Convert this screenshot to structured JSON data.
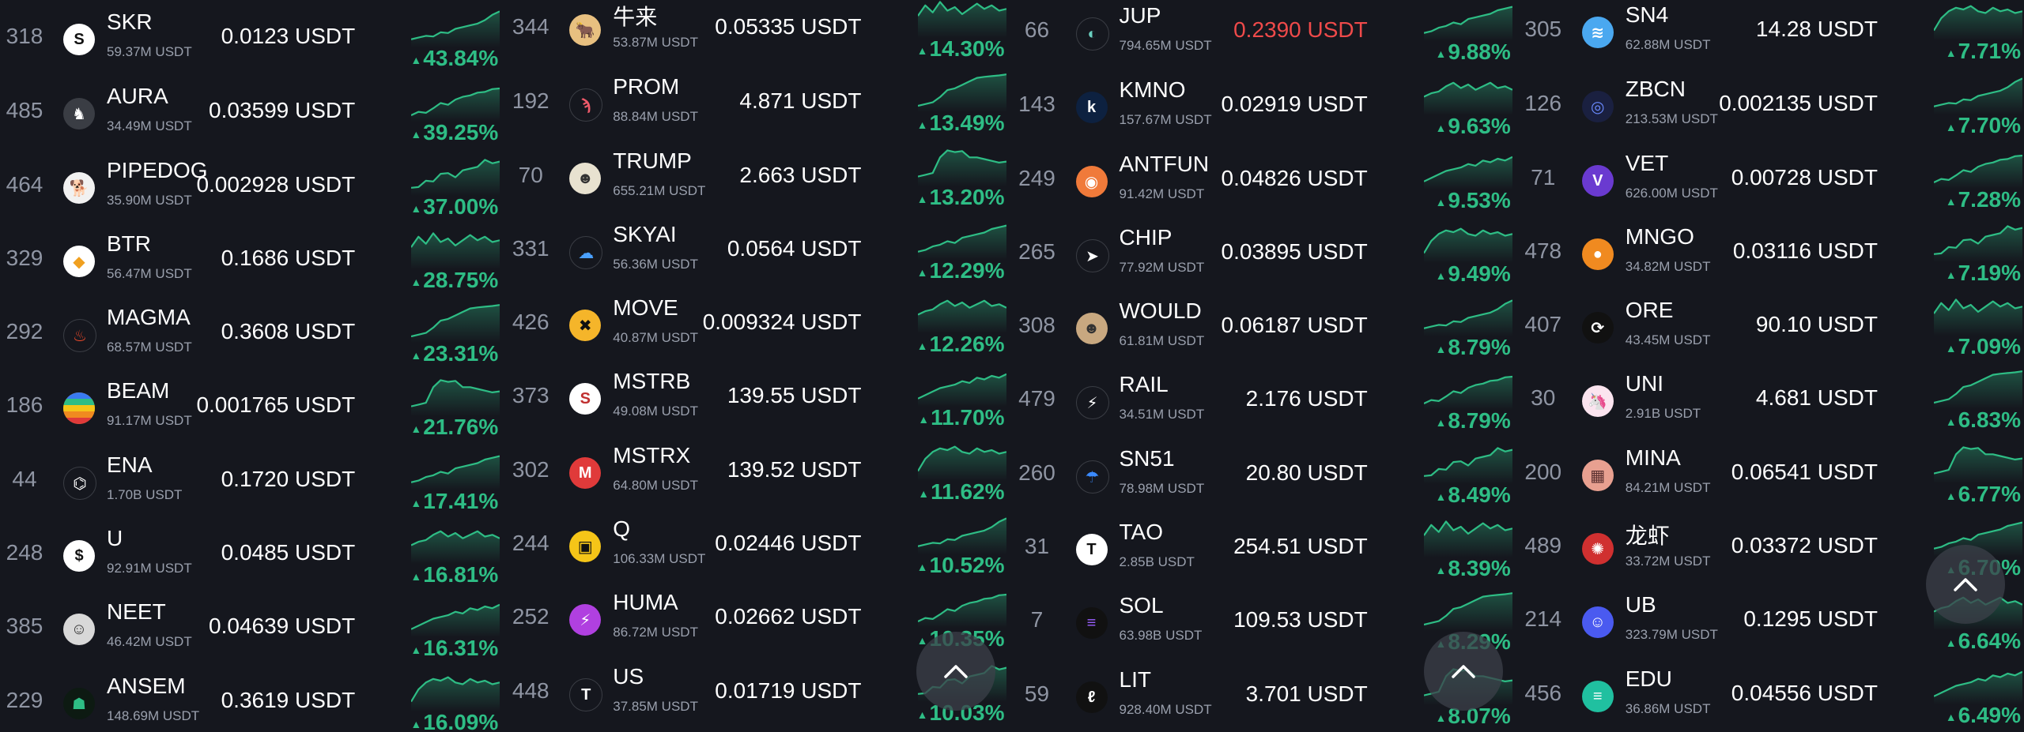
{
  "accent_up": "#2ebd85",
  "accent_down": "#ef4a4a",
  "panels": [
    {
      "rows": [
        {
          "rank": "318",
          "symbol": "SKR",
          "volume": "59.37M USDT",
          "price": "0.0123 USDT",
          "change": "43.84%",
          "logo_bg": "#ffffff",
          "logo_fg": "#111111",
          "logo_glyph": "S",
          "icon": "skr-icon"
        },
        {
          "rank": "485",
          "symbol": "AURA",
          "volume": "34.49M USDT",
          "price": "0.03599 USDT",
          "change": "39.25%",
          "logo_bg": "#3a3d44",
          "logo_fg": "#ffffff",
          "logo_glyph": "♞",
          "icon": "aura-icon"
        },
        {
          "rank": "464",
          "symbol": "PIPEDOG",
          "volume": "35.90M USDT",
          "price": "0.002928 USDT",
          "change": "37.00%",
          "logo_bg": "#f1f1f1",
          "logo_fg": "#7a5a30",
          "logo_glyph": "🐕",
          "icon": "pipedog-icon"
        },
        {
          "rank": "329",
          "symbol": "BTR",
          "volume": "56.47M USDT",
          "price": "0.1686 USDT",
          "change": "28.75%",
          "logo_bg": "#ffffff",
          "logo_fg": "#f0a020",
          "logo_glyph": "◆",
          "icon": "btr-icon"
        },
        {
          "rank": "292",
          "symbol": "MAGMA",
          "volume": "68.57M USDT",
          "price": "0.3608 USDT",
          "change": "23.31%",
          "logo_bg": "#15171e",
          "logo_fg": "#ef4a2a",
          "logo_glyph": "♨",
          "icon": "magma-icon"
        },
        {
          "rank": "186",
          "symbol": "BEAM",
          "volume": "91.17M USDT",
          "price": "0.001765 USDT",
          "change": "21.76%",
          "logo_bg": "#e8a030",
          "logo_fg": "#ffffff",
          "logo_glyph": "",
          "icon": "beam-icon"
        },
        {
          "rank": "44",
          "symbol": "ENA",
          "volume": "1.70B USDT",
          "price": "0.1720 USDT",
          "change": "17.41%",
          "logo_bg": "#15171e",
          "logo_fg": "#ffffff",
          "logo_glyph": "⌬",
          "icon": "ena-icon"
        },
        {
          "rank": "248",
          "symbol": "U",
          "volume": "92.91M USDT",
          "price": "0.0485 USDT",
          "change": "16.81%",
          "logo_bg": "#ffffff",
          "logo_fg": "#111111",
          "logo_glyph": "$",
          "icon": "u-icon"
        },
        {
          "rank": "385",
          "symbol": "NEET",
          "volume": "46.42M USDT",
          "price": "0.04639 USDT",
          "change": "16.31%",
          "logo_bg": "#d8d8d8",
          "logo_fg": "#333333",
          "logo_glyph": "☺",
          "icon": "neet-icon"
        },
        {
          "rank": "229",
          "symbol": "ANSEM",
          "volume": "148.69M USDT",
          "price": "0.3619 USDT",
          "change": "16.09%",
          "logo_bg": "#0d1a12",
          "logo_fg": "#2ebd85",
          "logo_glyph": "☗",
          "icon": "ansem-icon"
        }
      ]
    },
    {
      "rows": [
        {
          "rank": "344",
          "symbol": "牛来",
          "volume": "53.87M USDT",
          "price": "0.05335 USDT",
          "change": "14.30%",
          "logo_bg": "#e8c080",
          "logo_fg": "#5a3a10",
          "logo_glyph": "🐂",
          "icon": "niulai-icon"
        },
        {
          "rank": "192",
          "symbol": "PROM",
          "volume": "88.84M USDT",
          "price": "4.871 USDT",
          "change": "13.49%",
          "logo_bg": "#15171e",
          "logo_fg": "#ef5a6a",
          "logo_glyph": "ϡ",
          "icon": "prom-icon"
        },
        {
          "rank": "70",
          "symbol": "TRUMP",
          "volume": "655.21M USDT",
          "price": "2.663 USDT",
          "change": "13.20%",
          "logo_bg": "#e8e2d0",
          "logo_fg": "#333333",
          "logo_glyph": "☻",
          "icon": "trump-icon"
        },
        {
          "rank": "331",
          "symbol": "SKYAI",
          "volume": "56.36M USDT",
          "price": "0.0564 USDT",
          "change": "12.29%",
          "logo_bg": "#15171e",
          "logo_fg": "#4aa0ff",
          "logo_glyph": "☁",
          "icon": "skyai-icon"
        },
        {
          "rank": "426",
          "symbol": "MOVE",
          "volume": "40.87M USDT",
          "price": "0.009324 USDT",
          "change": "12.26%",
          "logo_bg": "#f5b52a",
          "logo_fg": "#111111",
          "logo_glyph": "✖",
          "icon": "move-icon"
        },
        {
          "rank": "373",
          "symbol": "MSTRB",
          "volume": "49.08M USDT",
          "price": "139.55 USDT",
          "change": "11.70%",
          "logo_bg": "#ffffff",
          "logo_fg": "#c03030",
          "logo_glyph": "S",
          "icon": "mstrb-icon"
        },
        {
          "rank": "302",
          "symbol": "MSTRX",
          "volume": "64.80M USDT",
          "price": "139.52 USDT",
          "change": "11.62%",
          "logo_bg": "#e03a3a",
          "logo_fg": "#ffffff",
          "logo_glyph": "M",
          "icon": "mstrx-icon"
        },
        {
          "rank": "244",
          "symbol": "Q",
          "volume": "106.33M USDT",
          "price": "0.02446 USDT",
          "change": "10.52%",
          "logo_bg": "#f5c518",
          "logo_fg": "#111111",
          "logo_glyph": "▣",
          "icon": "q-icon"
        },
        {
          "rank": "252",
          "symbol": "HUMA",
          "volume": "86.72M USDT",
          "price": "0.02662 USDT",
          "change": "10.35%",
          "logo_bg": "#b040e0",
          "logo_fg": "#ffffff",
          "logo_glyph": "⚡",
          "icon": "huma-icon"
        },
        {
          "rank": "448",
          "symbol": "US",
          "volume": "37.85M USDT",
          "price": "0.01719 USDT",
          "change": "10.03%",
          "logo_bg": "#15171e",
          "logo_fg": "#ffffff",
          "logo_glyph": "T",
          "icon": "us-icon"
        }
      ]
    },
    {
      "rows": [
        {
          "rank": "66",
          "symbol": "JUP",
          "volume": "794.65M USDT",
          "price": "0.2390 USDT",
          "change": "9.88%",
          "logo_bg": "#15171e",
          "logo_fg": "#6ad0c0",
          "logo_glyph": "◐",
          "icon": "jup-icon",
          "price_red": true
        },
        {
          "rank": "143",
          "symbol": "KMNO",
          "volume": "157.67M USDT",
          "price": "0.02919 USDT",
          "change": "9.63%",
          "logo_bg": "#0d2140",
          "logo_fg": "#ffffff",
          "logo_glyph": "k",
          "icon": "kmno-icon"
        },
        {
          "rank": "249",
          "symbol": "ANTFUN",
          "volume": "91.42M USDT",
          "price": "0.04826 USDT",
          "change": "9.53%",
          "logo_bg": "#f07a3a",
          "logo_fg": "#ffffff",
          "logo_glyph": "◉",
          "icon": "antfun-icon"
        },
        {
          "rank": "265",
          "symbol": "CHIP",
          "volume": "77.92M USDT",
          "price": "0.03895 USDT",
          "change": "9.49%",
          "logo_bg": "#15171e",
          "logo_fg": "#ffffff",
          "logo_glyph": "➤",
          "icon": "chip-icon"
        },
        {
          "rank": "308",
          "symbol": "WOULD",
          "volume": "61.81M USDT",
          "price": "0.06187 USDT",
          "change": "8.79%",
          "logo_bg": "#c8a880",
          "logo_fg": "#333333",
          "logo_glyph": "☻",
          "icon": "would-icon"
        },
        {
          "rank": "479",
          "symbol": "RAIL",
          "volume": "34.51M USDT",
          "price": "2.176 USDT",
          "change": "8.79%",
          "logo_bg": "#15171e",
          "logo_fg": "#ffffff",
          "logo_glyph": "⚡",
          "icon": "rail-icon"
        },
        {
          "rank": "260",
          "symbol": "SN51",
          "volume": "78.98M USDT",
          "price": "20.80 USDT",
          "change": "8.49%",
          "logo_bg": "#15171e",
          "logo_fg": "#3a8aff",
          "logo_glyph": "☂",
          "icon": "sn51-icon"
        },
        {
          "rank": "31",
          "symbol": "TAO",
          "volume": "2.85B USDT",
          "price": "254.51 USDT",
          "change": "8.39%",
          "logo_bg": "#ffffff",
          "logo_fg": "#111111",
          "logo_glyph": "T",
          "icon": "tao-icon"
        },
        {
          "rank": "7",
          "symbol": "SOL",
          "volume": "63.98B USDT",
          "price": "109.53 USDT",
          "change": "8.29%",
          "logo_bg": "#111111",
          "logo_fg": "#9a60ff",
          "logo_glyph": "≡",
          "icon": "sol-icon"
        },
        {
          "rank": "59",
          "symbol": "LIT",
          "volume": "928.40M USDT",
          "price": "3.701 USDT",
          "change": "8.07%",
          "logo_bg": "#111111",
          "logo_fg": "#ffffff",
          "logo_glyph": "ℓ",
          "icon": "lit-icon"
        }
      ]
    },
    {
      "rows": [
        {
          "rank": "305",
          "symbol": "SN4",
          "volume": "62.88M USDT",
          "price": "14.28 USDT",
          "change": "7.71%",
          "logo_bg": "#4aa8f0",
          "logo_fg": "#ffffff",
          "logo_glyph": "≋",
          "icon": "sn4-icon"
        },
        {
          "rank": "126",
          "symbol": "ZBCN",
          "volume": "213.53M USDT",
          "price": "0.002135 USDT",
          "change": "7.70%",
          "logo_bg": "#1a2040",
          "logo_fg": "#6a8aff",
          "logo_glyph": "◎",
          "icon": "zbcn-icon"
        },
        {
          "rank": "71",
          "symbol": "VET",
          "volume": "626.00M USDT",
          "price": "0.00728 USDT",
          "change": "7.28%",
          "logo_bg": "#6a3ad0",
          "logo_fg": "#ffffff",
          "logo_glyph": "V",
          "icon": "vet-icon"
        },
        {
          "rank": "478",
          "symbol": "MNGO",
          "volume": "34.82M USDT",
          "price": "0.03116 USDT",
          "change": "7.19%",
          "logo_bg": "#f08a20",
          "logo_fg": "#ffffff",
          "logo_glyph": "●",
          "icon": "mngo-icon"
        },
        {
          "rank": "407",
          "symbol": "ORE",
          "volume": "43.45M USDT",
          "price": "90.10 USDT",
          "change": "7.09%",
          "logo_bg": "#111111",
          "logo_fg": "#ffffff",
          "logo_glyph": "⟳",
          "icon": "ore-icon"
        },
        {
          "rank": "30",
          "symbol": "UNI",
          "volume": "2.91B USDT",
          "price": "4.681 USDT",
          "change": "6.83%",
          "logo_bg": "#fbe4ef",
          "logo_fg": "#e0207a",
          "logo_glyph": "🦄",
          "icon": "uni-icon"
        },
        {
          "rank": "200",
          "symbol": "MINA",
          "volume": "84.21M USDT",
          "price": "0.06541 USDT",
          "change": "6.77%",
          "logo_bg": "#e8a090",
          "logo_fg": "#5a3030",
          "logo_glyph": "▦",
          "icon": "mina-icon"
        },
        {
          "rank": "489",
          "symbol": "龙虾",
          "volume": "33.72M USDT",
          "price": "0.03372 USDT",
          "change": "6.70%",
          "logo_bg": "#d03030",
          "logo_fg": "#ffffff",
          "logo_glyph": "✺",
          "icon": "longxia-icon"
        },
        {
          "rank": "214",
          "symbol": "UB",
          "volume": "323.79M USDT",
          "price": "0.1295 USDT",
          "change": "6.64%",
          "logo_bg": "#4a5af0",
          "logo_fg": "#ffffff",
          "logo_glyph": "☺",
          "icon": "ub-icon"
        },
        {
          "rank": "456",
          "symbol": "EDU",
          "volume": "36.86M USDT",
          "price": "0.04556 USDT",
          "change": "6.49%",
          "logo_bg": "#20c0a0",
          "logo_fg": "#ffffff",
          "logo_glyph": "≡",
          "icon": "edu-icon"
        }
      ]
    }
  ]
}
